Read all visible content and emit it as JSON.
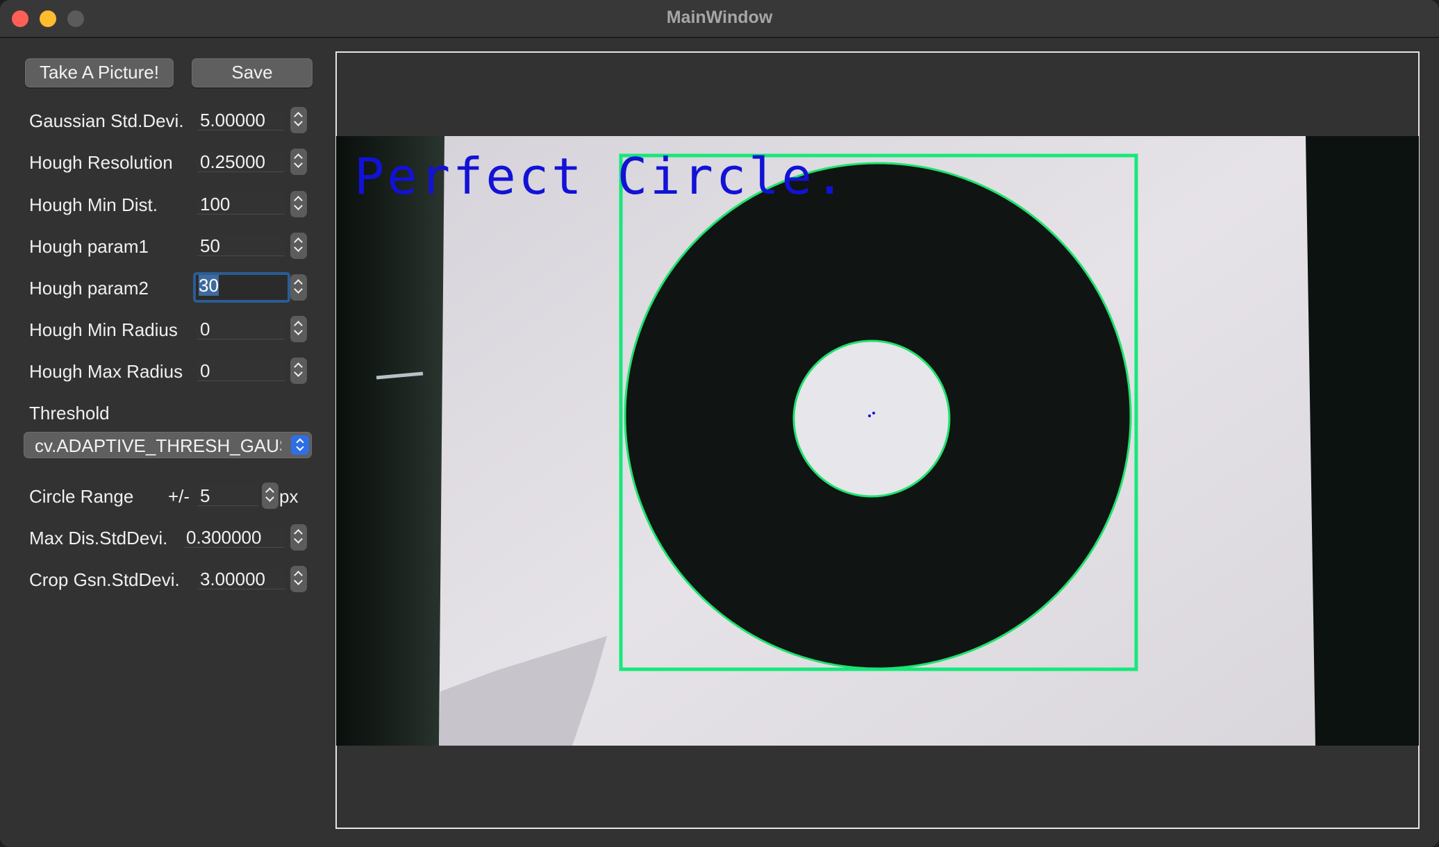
{
  "window": {
    "title": "MainWindow"
  },
  "toolbar": {
    "take_picture_label": "Take A Picture!",
    "save_label": "Save"
  },
  "params": [
    {
      "label": "Gaussian Std.Devi.",
      "value": "5.00000"
    },
    {
      "label": "Hough Resolution",
      "value": "0.25000"
    },
    {
      "label": "Hough Min Dist.",
      "value": "100"
    },
    {
      "label": "Hough param1",
      "value": "50"
    },
    {
      "label": "Hough param2",
      "value": "30"
    },
    {
      "label": "Hough Min Radius",
      "value": "0"
    },
    {
      "label": "Hough Max Radius",
      "value": "0"
    }
  ],
  "threshold": {
    "label": "Threshold",
    "selected": "cv.ADAPTIVE_THRESH_GAUSSIAN_C"
  },
  "circle_range": {
    "label": "Circle Range",
    "prefix": "+/-",
    "value": "5",
    "unit": "px"
  },
  "max_dis": {
    "label": "Max Dis.StdDevi.",
    "value": "0.300000"
  },
  "crop_gsn": {
    "label": "Crop Gsn.StdDevi.",
    "value": "3.00000"
  },
  "image": {
    "overlay_text": "Perfect Circle.",
    "detection_color": "#16e87a",
    "text_color": "#1212d6"
  },
  "icons": {
    "close": "close-icon",
    "minimize": "minimize-icon",
    "maximize": "maximize-icon",
    "spinner": "stepper-arrows-icon",
    "select": "dropdown-arrows-icon"
  }
}
